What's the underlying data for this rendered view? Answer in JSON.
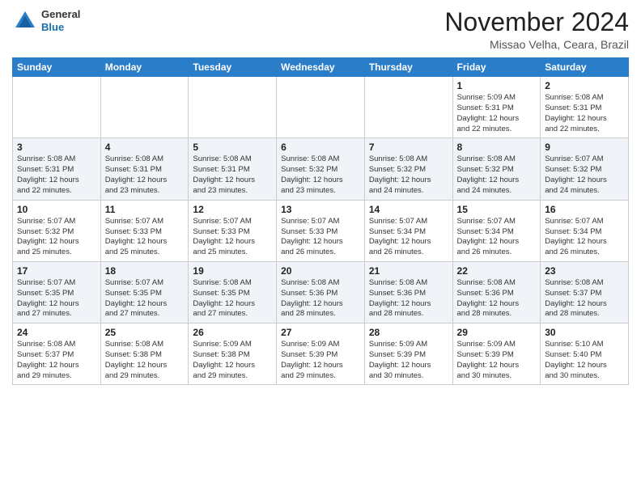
{
  "header": {
    "logo_general": "General",
    "logo_blue": "Blue",
    "month_title": "November 2024",
    "location": "Missao Velha, Ceara, Brazil"
  },
  "calendar": {
    "headers": [
      "Sunday",
      "Monday",
      "Tuesday",
      "Wednesday",
      "Thursday",
      "Friday",
      "Saturday"
    ],
    "weeks": [
      [
        {
          "day": "",
          "info": ""
        },
        {
          "day": "",
          "info": ""
        },
        {
          "day": "",
          "info": ""
        },
        {
          "day": "",
          "info": ""
        },
        {
          "day": "",
          "info": ""
        },
        {
          "day": "1",
          "info": "Sunrise: 5:09 AM\nSunset: 5:31 PM\nDaylight: 12 hours\nand 22 minutes."
        },
        {
          "day": "2",
          "info": "Sunrise: 5:08 AM\nSunset: 5:31 PM\nDaylight: 12 hours\nand 22 minutes."
        }
      ],
      [
        {
          "day": "3",
          "info": "Sunrise: 5:08 AM\nSunset: 5:31 PM\nDaylight: 12 hours\nand 22 minutes."
        },
        {
          "day": "4",
          "info": "Sunrise: 5:08 AM\nSunset: 5:31 PM\nDaylight: 12 hours\nand 23 minutes."
        },
        {
          "day": "5",
          "info": "Sunrise: 5:08 AM\nSunset: 5:31 PM\nDaylight: 12 hours\nand 23 minutes."
        },
        {
          "day": "6",
          "info": "Sunrise: 5:08 AM\nSunset: 5:32 PM\nDaylight: 12 hours\nand 23 minutes."
        },
        {
          "day": "7",
          "info": "Sunrise: 5:08 AM\nSunset: 5:32 PM\nDaylight: 12 hours\nand 24 minutes."
        },
        {
          "day": "8",
          "info": "Sunrise: 5:08 AM\nSunset: 5:32 PM\nDaylight: 12 hours\nand 24 minutes."
        },
        {
          "day": "9",
          "info": "Sunrise: 5:07 AM\nSunset: 5:32 PM\nDaylight: 12 hours\nand 24 minutes."
        }
      ],
      [
        {
          "day": "10",
          "info": "Sunrise: 5:07 AM\nSunset: 5:32 PM\nDaylight: 12 hours\nand 25 minutes."
        },
        {
          "day": "11",
          "info": "Sunrise: 5:07 AM\nSunset: 5:33 PM\nDaylight: 12 hours\nand 25 minutes."
        },
        {
          "day": "12",
          "info": "Sunrise: 5:07 AM\nSunset: 5:33 PM\nDaylight: 12 hours\nand 25 minutes."
        },
        {
          "day": "13",
          "info": "Sunrise: 5:07 AM\nSunset: 5:33 PM\nDaylight: 12 hours\nand 26 minutes."
        },
        {
          "day": "14",
          "info": "Sunrise: 5:07 AM\nSunset: 5:34 PM\nDaylight: 12 hours\nand 26 minutes."
        },
        {
          "day": "15",
          "info": "Sunrise: 5:07 AM\nSunset: 5:34 PM\nDaylight: 12 hours\nand 26 minutes."
        },
        {
          "day": "16",
          "info": "Sunrise: 5:07 AM\nSunset: 5:34 PM\nDaylight: 12 hours\nand 26 minutes."
        }
      ],
      [
        {
          "day": "17",
          "info": "Sunrise: 5:07 AM\nSunset: 5:35 PM\nDaylight: 12 hours\nand 27 minutes."
        },
        {
          "day": "18",
          "info": "Sunrise: 5:07 AM\nSunset: 5:35 PM\nDaylight: 12 hours\nand 27 minutes."
        },
        {
          "day": "19",
          "info": "Sunrise: 5:08 AM\nSunset: 5:35 PM\nDaylight: 12 hours\nand 27 minutes."
        },
        {
          "day": "20",
          "info": "Sunrise: 5:08 AM\nSunset: 5:36 PM\nDaylight: 12 hours\nand 28 minutes."
        },
        {
          "day": "21",
          "info": "Sunrise: 5:08 AM\nSunset: 5:36 PM\nDaylight: 12 hours\nand 28 minutes."
        },
        {
          "day": "22",
          "info": "Sunrise: 5:08 AM\nSunset: 5:36 PM\nDaylight: 12 hours\nand 28 minutes."
        },
        {
          "day": "23",
          "info": "Sunrise: 5:08 AM\nSunset: 5:37 PM\nDaylight: 12 hours\nand 28 minutes."
        }
      ],
      [
        {
          "day": "24",
          "info": "Sunrise: 5:08 AM\nSunset: 5:37 PM\nDaylight: 12 hours\nand 29 minutes."
        },
        {
          "day": "25",
          "info": "Sunrise: 5:08 AM\nSunset: 5:38 PM\nDaylight: 12 hours\nand 29 minutes."
        },
        {
          "day": "26",
          "info": "Sunrise: 5:09 AM\nSunset: 5:38 PM\nDaylight: 12 hours\nand 29 minutes."
        },
        {
          "day": "27",
          "info": "Sunrise: 5:09 AM\nSunset: 5:39 PM\nDaylight: 12 hours\nand 29 minutes."
        },
        {
          "day": "28",
          "info": "Sunrise: 5:09 AM\nSunset: 5:39 PM\nDaylight: 12 hours\nand 30 minutes."
        },
        {
          "day": "29",
          "info": "Sunrise: 5:09 AM\nSunset: 5:39 PM\nDaylight: 12 hours\nand 30 minutes."
        },
        {
          "day": "30",
          "info": "Sunrise: 5:10 AM\nSunset: 5:40 PM\nDaylight: 12 hours\nand 30 minutes."
        }
      ]
    ]
  }
}
